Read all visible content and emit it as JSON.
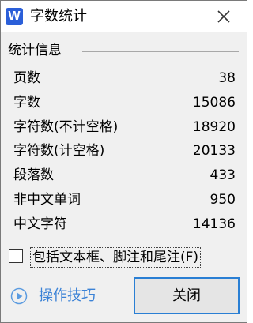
{
  "window": {
    "app_icon_letter": "W",
    "title": "字数统计",
    "close_icon": "close-icon"
  },
  "stats": {
    "group_label": "统计信息",
    "rows": [
      {
        "label": "页数",
        "value": "38"
      },
      {
        "label": "字数",
        "value": "15086"
      },
      {
        "label": "字符数(不计空格)",
        "value": "18920"
      },
      {
        "label": "字符数(计空格)",
        "value": "20133"
      },
      {
        "label": "段落数",
        "value": "433"
      },
      {
        "label": "非中文单词",
        "value": "950"
      },
      {
        "label": "中文字符",
        "value": "14136"
      }
    ]
  },
  "options": {
    "include_textboxes_label": "包括文本框、脚注和尾注(F)",
    "include_textboxes_checked": false
  },
  "footer": {
    "tips_icon": "play-circle-icon",
    "tips_label": "操作技巧",
    "close_label": "关闭"
  },
  "colors": {
    "app_icon": "#2b5fd9",
    "link": "#3b82d6",
    "focus_border": "#2a7fd4"
  }
}
